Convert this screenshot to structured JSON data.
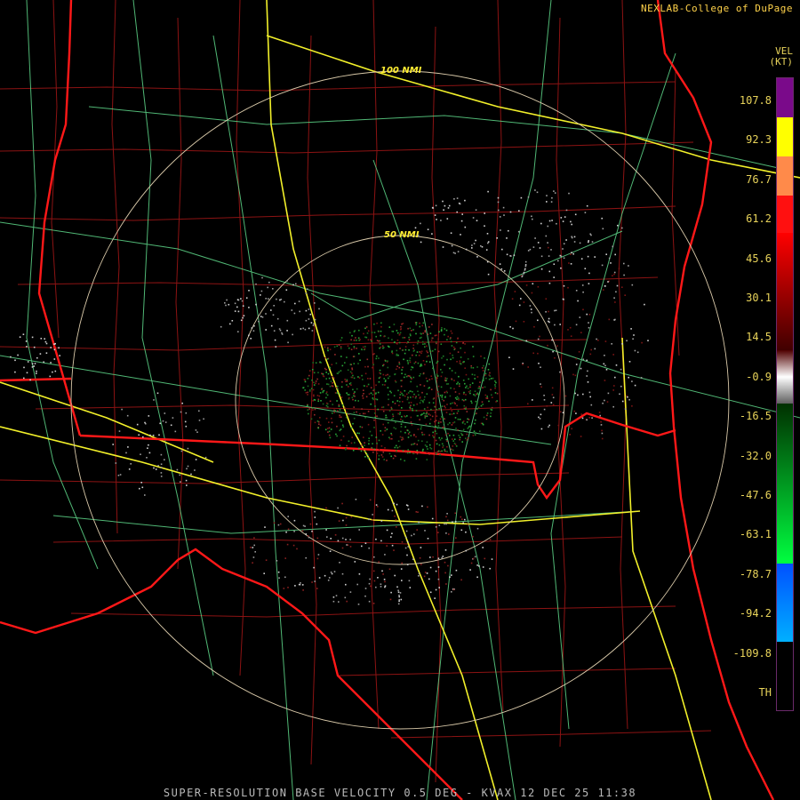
{
  "header": {
    "credit": "NEXLAB-College of DuPage"
  },
  "footer": {
    "product": "SUPER-RESOLUTION BASE VELOCITY 0.5 DEG - KVAX 12 DEC 25 11:38"
  },
  "legend": {
    "title": "VEL",
    "unit": "(KT)",
    "ticks": [
      "107.8",
      "92.3",
      "76.7",
      "61.2",
      "45.6",
      "30.1",
      "14.5",
      "-0.9",
      "-16.5",
      "-32.0",
      "-47.6",
      "-63.1",
      "-78.7",
      "-94.2",
      "-109.8",
      "TH"
    ]
  },
  "rings": {
    "inner": "50 NMI",
    "outer": "100 NMI"
  },
  "colors": {
    "state_line": "#ff1a1a",
    "county_line": "#a01414",
    "highway": "#ffff33",
    "road": "#6fe29a",
    "range_ring": "#d8c8a8"
  }
}
